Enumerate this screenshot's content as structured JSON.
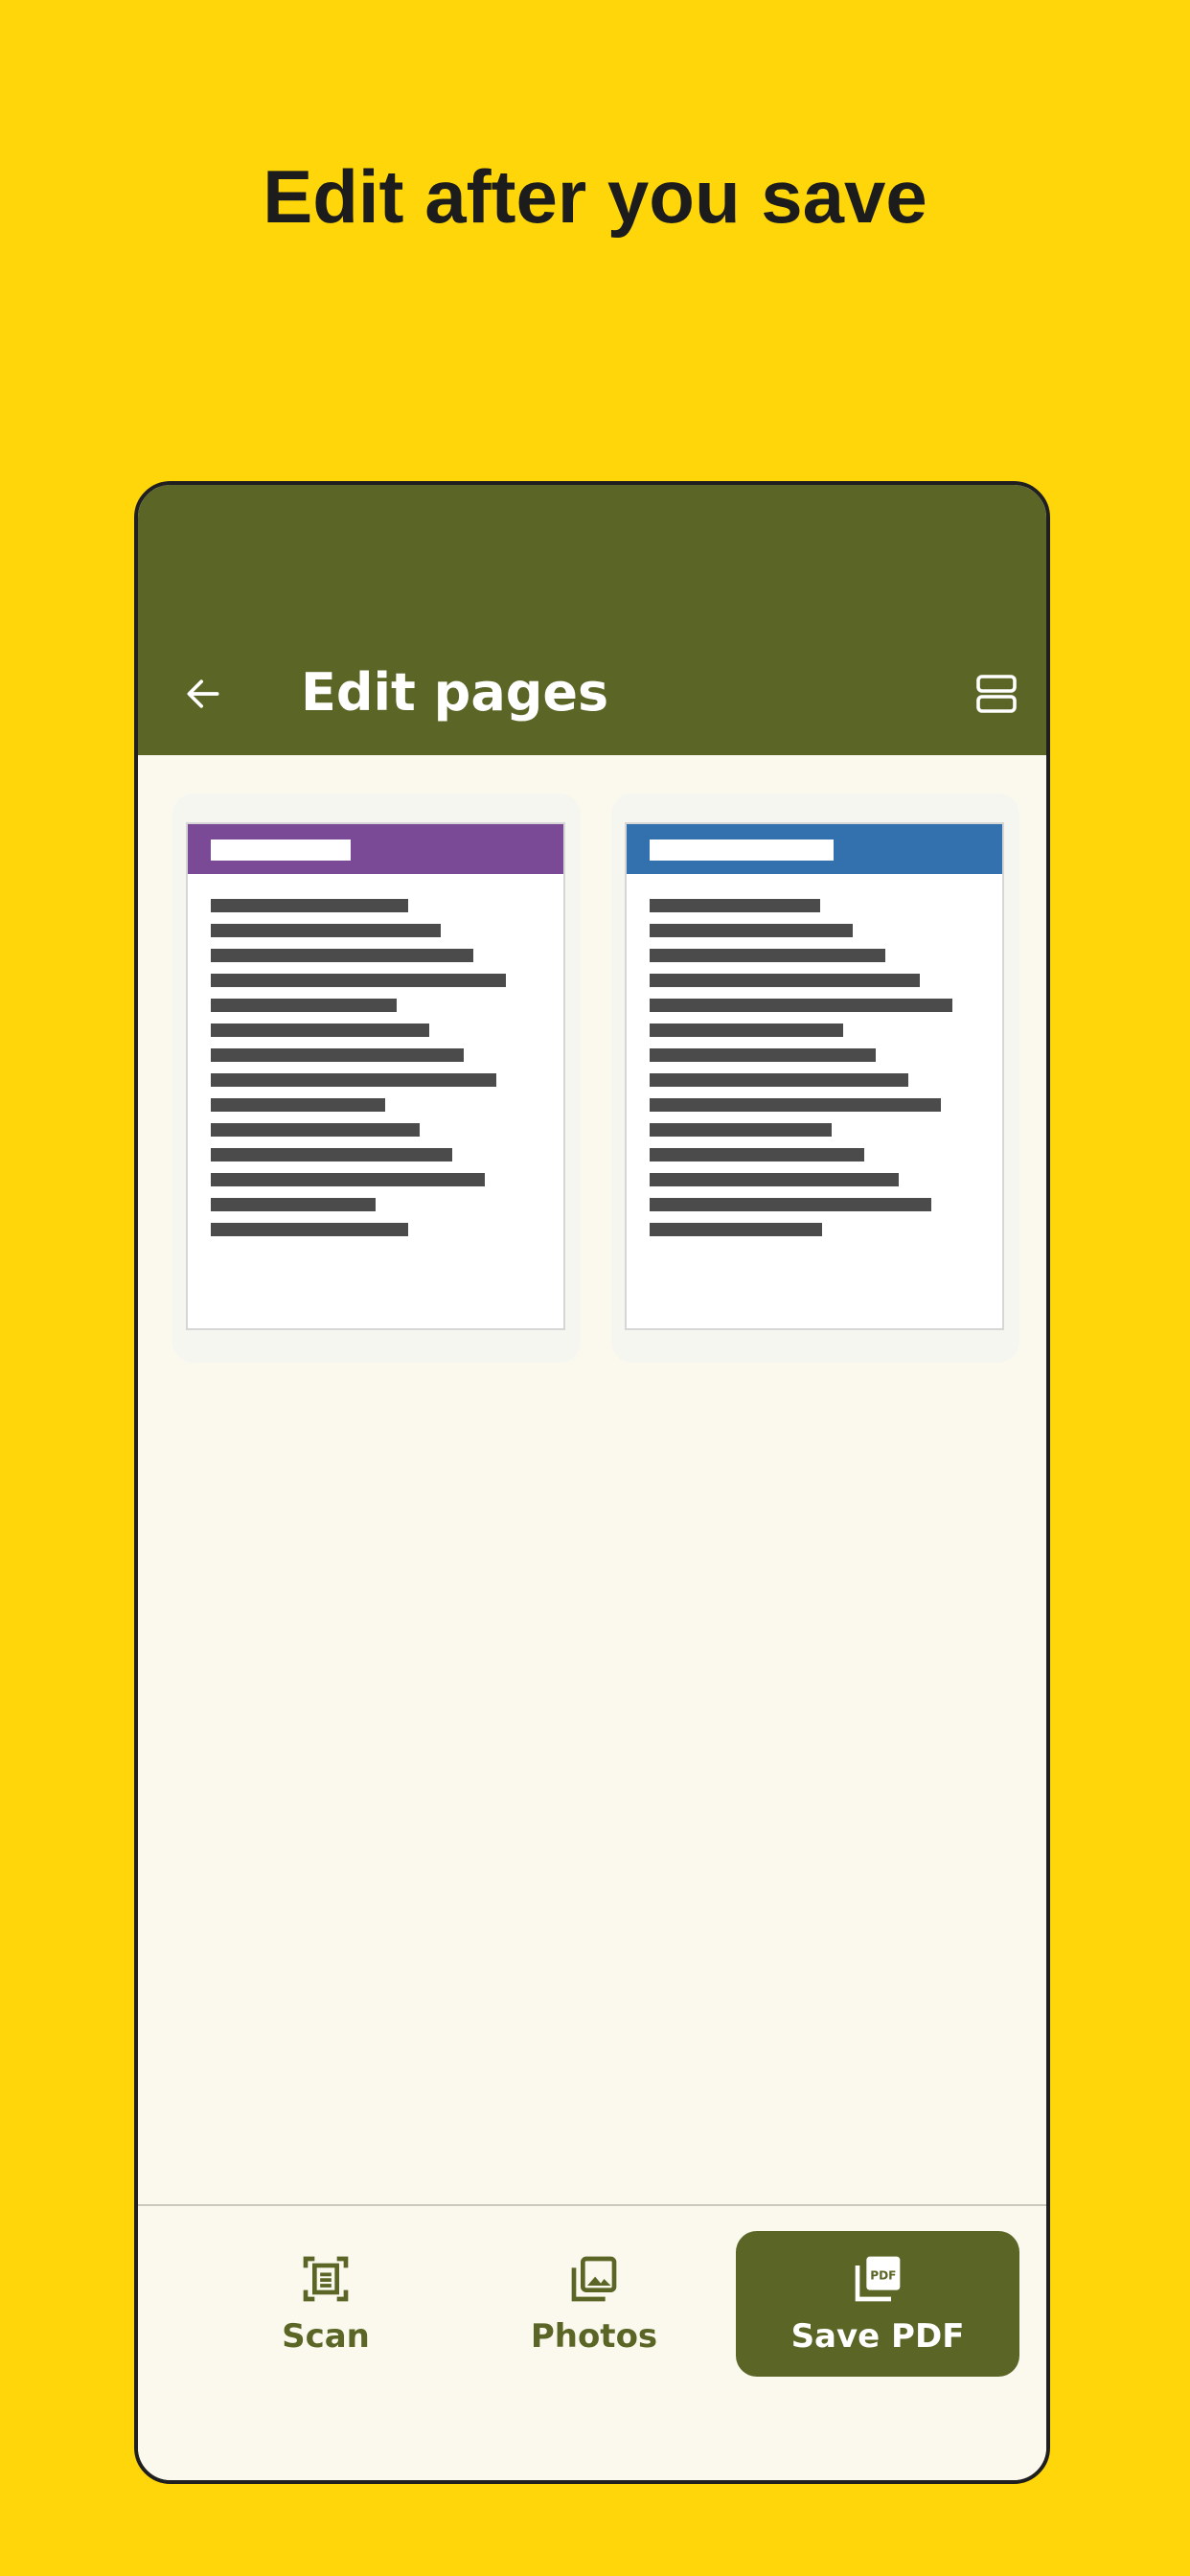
{
  "headline": "Edit after you save",
  "appbar": {
    "title": "Edit pages",
    "back_icon": "arrow-left-icon",
    "layout_icon": "view-agenda-icon"
  },
  "colors": {
    "background": "#FFD60A",
    "appbar": "#5A6526",
    "page1_header": "#7B4A97",
    "page2_header": "#3370AE"
  },
  "pages": [
    {
      "header_color": "#7B4A97"
    },
    {
      "header_color": "#3370AE"
    }
  ],
  "bottom_nav": {
    "items": [
      {
        "label": "Scan",
        "icon": "document-scan-icon",
        "active": false
      },
      {
        "label": "Photos",
        "icon": "photo-library-icon",
        "active": false
      },
      {
        "label": "Save PDF",
        "icon": "pdf-icon",
        "active": true
      }
    ]
  }
}
